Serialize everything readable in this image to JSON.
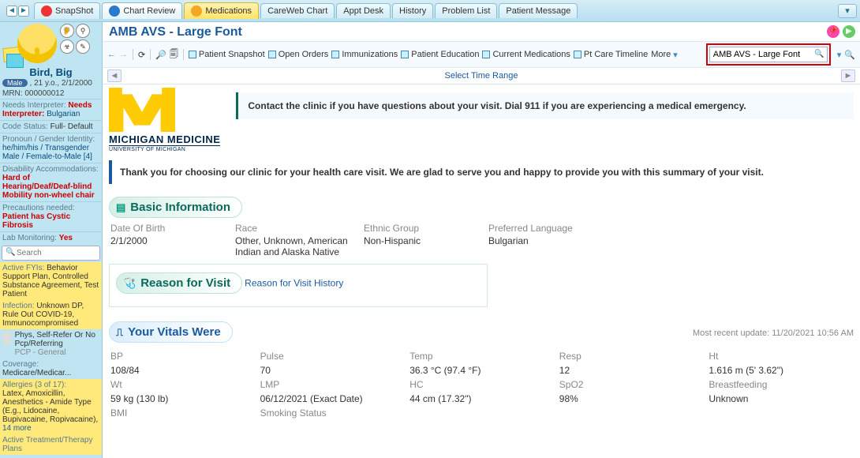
{
  "topTabs": {
    "snapshot": "SnapShot",
    "chartReview": "Chart Review",
    "medications": "Medications",
    "careweb": "CareWeb Chart",
    "apptDesk": "Appt Desk",
    "history": "History",
    "problemList": "Problem List",
    "patientMessage": "Patient Message"
  },
  "patient": {
    "name": "Bird, Big",
    "sexPill": "Male",
    "ageDob": ", 21 y.o., 2/1/2000",
    "mrnLabel": "MRN:",
    "mrn": "000000012",
    "interpLabel": "Needs Interpreter:",
    "interpNeeds": "Needs Interpreter:",
    "interpLang": "Bulgarian",
    "codeStatusLabel": "Code Status:",
    "codeStatus": "Full- Default",
    "pronounLabel": "Pronoun / Gender Identity:",
    "pronoun": "he/him/his / Transgender Male / Female-to-Male [4]",
    "disabilityLabel": "Disability Accommodations:",
    "disability": "Hard of Hearing/Deaf/Deaf-blind Mobility non-wheel chair",
    "precautionsLabel": "Precautions needed:",
    "precautions": "Patient has Cystic Fibrosis",
    "labMonLabel": "Lab Monitoring:",
    "labMon": "Yes"
  },
  "sideSearch": {
    "placeholder": "Search"
  },
  "fyi": {
    "activeFyiLabel": "Active FYIs:",
    "activeFyi": "Behavior Support Plan, Controlled Substance Agreement, Test Patient",
    "infectionLabel": "Infection:",
    "infection": "Unknown DP, Rule Out COVID-19, Immunocompromised",
    "physLine": "Phys, Self-Refer Or No Pcp/Referring",
    "physSub": "PCP - General",
    "coverageLabel": "Coverage:",
    "coverage": "Medicare/Medicar...",
    "allergiesLabel": "Allergies (3 of 17):",
    "allergies": "Latex, Amoxicillin, Anesthetics - Amide Type (E.g., Lidocaine, Bupivacaine, Ropivacaine),",
    "allergiesMore": "14 more",
    "activeTxLabel": "Active Treatment/Therapy Plans"
  },
  "doc": {
    "title": "AMB AVS - Large Font",
    "timeRange": "Select Time Range",
    "searchValue": "AMB AVS - Large Font"
  },
  "toolbar": {
    "patientSnapshot": "Patient Snapshot",
    "openOrders": "Open Orders",
    "immunizations": "Immunizations",
    "patientEducation": "Patient Education",
    "currentMeds": "Current Medications",
    "ptCare": "Pt Care Timeline",
    "more": "More"
  },
  "logo": {
    "title": "MICHIGAN MEDICINE",
    "sub": "UNIVERSITY OF MICHIGAN"
  },
  "alert": "Contact the clinic if you have questions about your visit.  Dial 911 if you are experiencing a medical emergency.",
  "thankyou": "Thank you for choosing our clinic for your health care visit.  We are glad to serve you and happy to provide you with this summary of your visit.",
  "sections": {
    "basicInfo": "Basic Information",
    "reasonVisit": "Reason for Visit",
    "reasonVisitLink": "Reason for Visit History",
    "vitals": "Your Vitals Were",
    "vitalsTs": "Most recent update: 11/20/2021 10:56 AM"
  },
  "basicInfo": {
    "dobL": "Date Of Birth",
    "dob": "2/1/2000",
    "raceL": "Race",
    "race": "Other, Unknown, American Indian and Alaska Native",
    "ethnicL": "Ethnic Group",
    "ethnic": "Non-Hispanic",
    "langL": "Preferred Language",
    "lang": "Bulgarian"
  },
  "vitals": {
    "bpL": "BP",
    "bp": "108/84",
    "pulseL": "Pulse",
    "pulse": "70",
    "tempL": "Temp",
    "temp": "36.3 °C (97.4 °F)",
    "respL": "Resp",
    "resp": "12",
    "htL": "Ht",
    "ht": "1.616 m (5' 3.62\")",
    "wtL": "Wt",
    "wt": "59 kg (130 lb)",
    "lmpL": "LMP",
    "lmp": "06/12/2021 (Exact Date)",
    "hcL": "HC",
    "hc": "44 cm (17.32\")",
    "spo2L": "SpO2",
    "spo2": "98%",
    "bfL": "Breastfeeding",
    "bf": "Unknown",
    "bmiL": "BMI",
    "smokeL": "Smoking Status"
  }
}
